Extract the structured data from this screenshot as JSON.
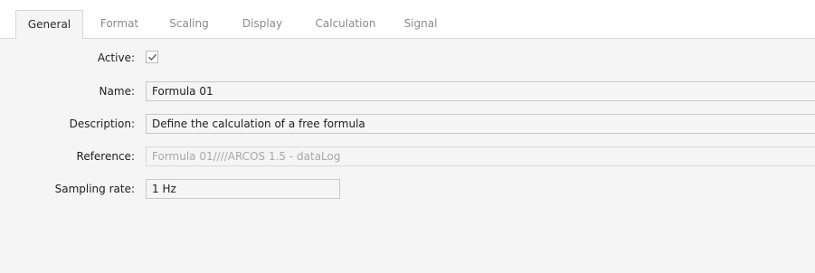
{
  "tabs": [
    {
      "label": "General",
      "active": true
    },
    {
      "label": "Format",
      "active": false
    },
    {
      "label": "Scaling",
      "active": false
    },
    {
      "label": "Display",
      "active": false
    },
    {
      "label": "Calculation",
      "active": false
    },
    {
      "label": "Signal",
      "active": false
    }
  ],
  "form": {
    "active": {
      "label": "Active:",
      "checked": true
    },
    "name": {
      "label": "Name:",
      "value": "Formula 01"
    },
    "description": {
      "label": "Description:",
      "value": "Define the calculation of a free formula"
    },
    "reference": {
      "label": "Reference:",
      "value": "Formula 01////ARCOS 1.5 - dataLog",
      "disabled": true
    },
    "sampling_rate": {
      "label": "Sampling rate:",
      "value": "1 Hz"
    }
  },
  "colors": {
    "panel_background": "#f5f5f5",
    "field_border": "#c8c8c8",
    "inactive_tab_text": "#8a8a8a",
    "disabled_text": "#a8a8a8",
    "check_mark": "#6e6e6e"
  },
  "icons": {
    "active_checkbox": "check-icon"
  }
}
